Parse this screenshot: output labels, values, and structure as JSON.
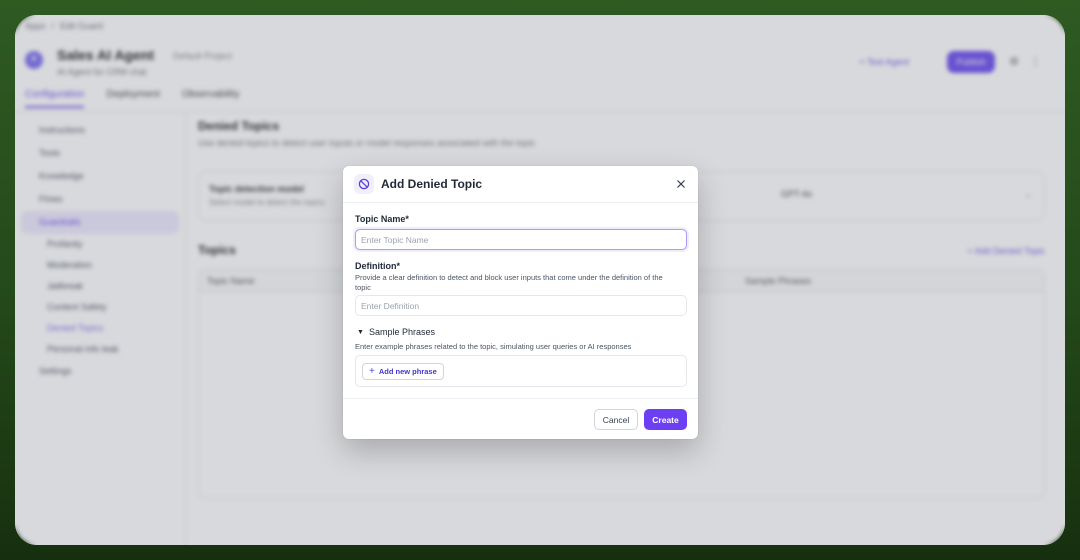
{
  "background": {
    "breadcrumb": [
      "Apps",
      "/",
      "Edit Guard"
    ],
    "app_name": "Sales AI Agent",
    "app_badge": "Default Project",
    "app_sub": "AI Agent for CRM chat",
    "header_link": "+ Test Agent",
    "header_primary": "Publish",
    "tabs": [
      "Configuration",
      "Deployment",
      "Observability"
    ],
    "sidebar": {
      "items": [
        "Instructions",
        "Tools",
        "Knowledge",
        "Flows",
        "Guardrails",
        "Settings"
      ],
      "sub_items": [
        "Profanity",
        "Moderation",
        "Jailbreak",
        "Content Safety",
        "Denied Topics",
        "Personal info leak"
      ]
    },
    "section_title": "Denied Topics",
    "section_desc": "Use denied topics to detect user inputs or model responses associated with the topic",
    "card_title": "Topic detection model",
    "card_desc": "Select model to detect the topics",
    "card_status": "GPT-4o",
    "topics_title": "Topics",
    "topics_link": "+ Add Denied Topic",
    "table_headers": [
      "Topic Name",
      "Sample Phrases"
    ]
  },
  "modal": {
    "title": "Add Denied Topic",
    "icon": "block-icon",
    "topic_name": {
      "label": "Topic Name*",
      "value": "",
      "placeholder": "Enter Topic Name"
    },
    "definition": {
      "label": "Definition*",
      "help": "Provide a clear definition to detect and block user inputs that come under the definition of the topic",
      "value": "",
      "placeholder": "Enter Definition"
    },
    "sample_phrases": {
      "label": "Sample Phrases",
      "caret": "▼",
      "help": "Enter example phrases related to the topic, simulating user queries or AI responses",
      "add_label": "Add new phrase",
      "add_icon": "+"
    },
    "cancel_label": "Cancel",
    "create_label": "Create",
    "colors": {
      "primary": "#6d3ff2",
      "focus_ring": "#a89df5",
      "link": "#4338ca"
    }
  }
}
